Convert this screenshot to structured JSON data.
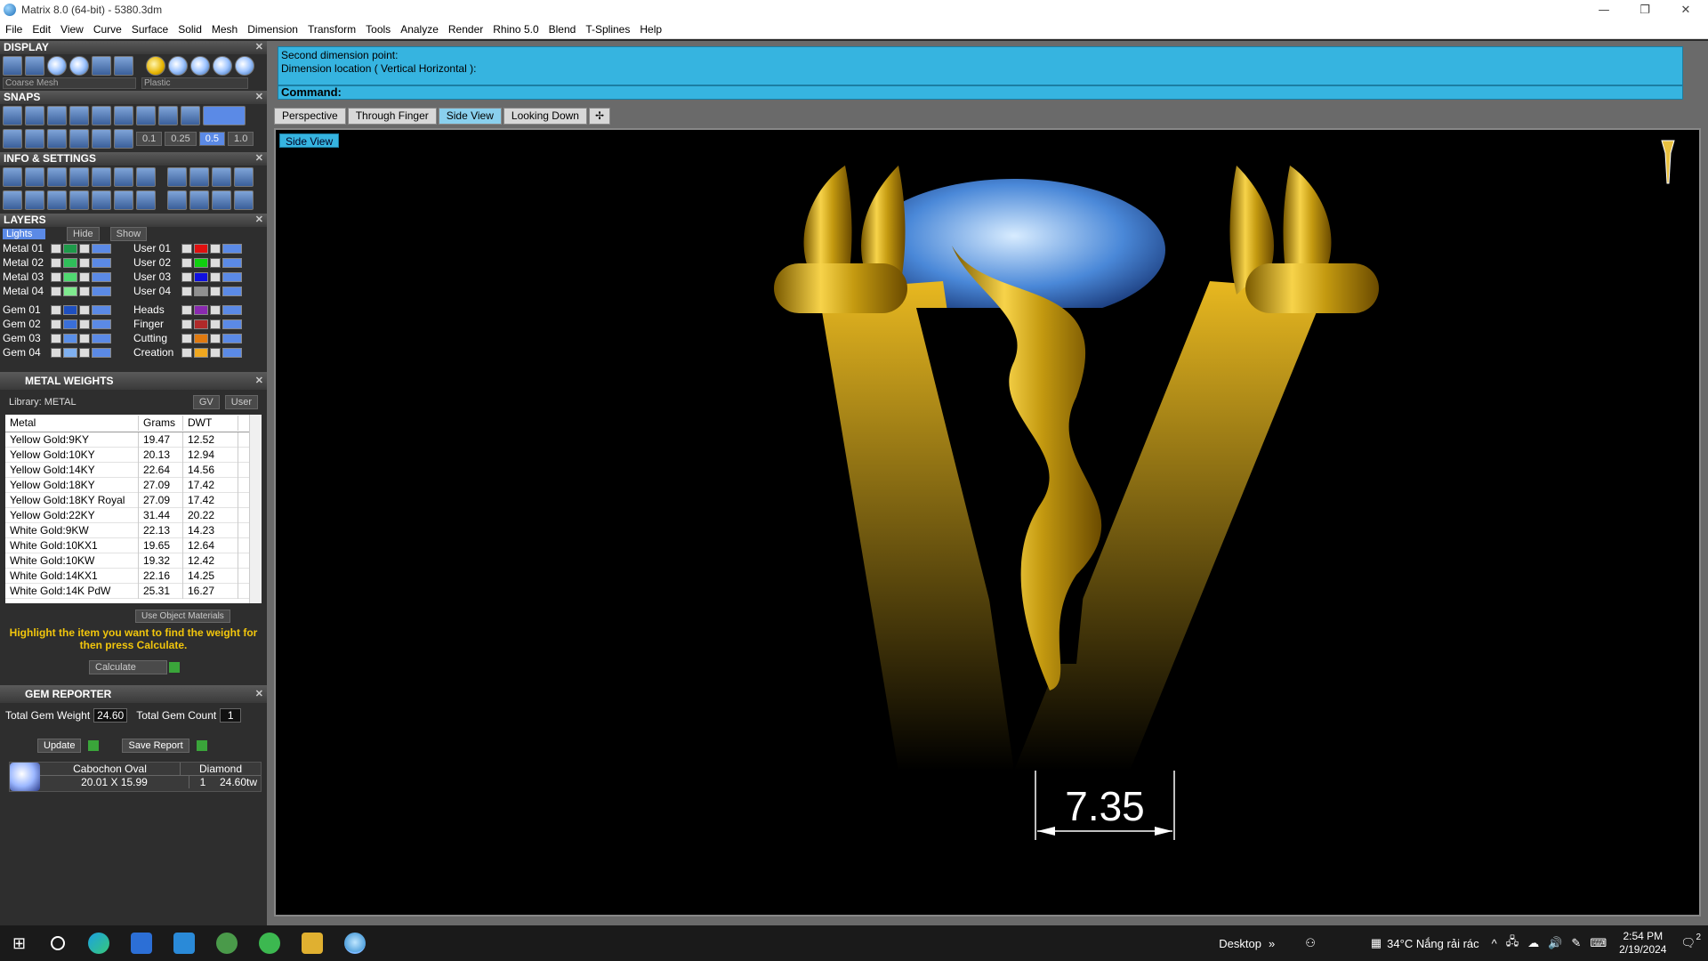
{
  "window": {
    "title": "Matrix 8.0 (64-bit) - 5380.3dm"
  },
  "menu": [
    "File",
    "Edit",
    "View",
    "Curve",
    "Surface",
    "Solid",
    "Mesh",
    "Dimension",
    "Transform",
    "Tools",
    "Analyze",
    "Render",
    "Rhino 5.0",
    "Blend",
    "T-Splines",
    "Help"
  ],
  "display": {
    "header": "DISPLAY",
    "mesh": "Coarse Mesh",
    "material": "Plastic"
  },
  "snaps": {
    "header": "SNAPS",
    "values": [
      "0.1",
      "0.25",
      "0.5",
      "1.0"
    ]
  },
  "info": {
    "header": "INFO & SETTINGS"
  },
  "layers": {
    "header": "LAYERS",
    "lights": "Lights",
    "hide": "Hide",
    "show": "Show",
    "left": [
      {
        "name": "Metal 01",
        "color": "#1e9a4a"
      },
      {
        "name": "Metal 02",
        "color": "#2fbf5a"
      },
      {
        "name": "Metal 03",
        "color": "#4fd870"
      },
      {
        "name": "Metal 04",
        "color": "#7fe98f"
      },
      {
        "name": "Gem 01",
        "color": "#1e4fbf"
      },
      {
        "name": "Gem 02",
        "color": "#3a6fd8"
      },
      {
        "name": "Gem 03",
        "color": "#5a8fe8"
      },
      {
        "name": "Gem 04",
        "color": "#7fb0f0"
      }
    ],
    "right": [
      {
        "name": "User 01",
        "color": "#e01010"
      },
      {
        "name": "User 02",
        "color": "#10d010"
      },
      {
        "name": "User 03",
        "color": "#1010e0"
      },
      {
        "name": "User 04",
        "color": "#909090"
      },
      {
        "name": "Heads",
        "color": "#8a2ab0"
      },
      {
        "name": "Finger",
        "color": "#b02a2a"
      },
      {
        "name": "Cutting",
        "color": "#e07a10"
      },
      {
        "name": "Creation",
        "color": "#f0a820"
      }
    ]
  },
  "metal_weights": {
    "header": "METAL WEIGHTS",
    "library": "Library: METAL",
    "gv": "GV",
    "user": "User",
    "columns": [
      "Metal",
      "Grams",
      "DWT"
    ],
    "rows": [
      [
        "Yellow Gold:9KY",
        "19.47",
        "12.52"
      ],
      [
        "Yellow Gold:10KY",
        "20.13",
        "12.94"
      ],
      [
        "Yellow Gold:14KY",
        "22.64",
        "14.56"
      ],
      [
        "Yellow Gold:18KY",
        "27.09",
        "17.42"
      ],
      [
        "Yellow Gold:18KY Royal",
        "27.09",
        "17.42"
      ],
      [
        "Yellow Gold:22KY",
        "31.44",
        "20.22"
      ],
      [
        "White Gold:9KW",
        "22.13",
        "14.23"
      ],
      [
        "White Gold:10KX1",
        "19.65",
        "12.64"
      ],
      [
        "White Gold:10KW",
        "19.32",
        "12.42"
      ],
      [
        "White Gold:14KX1",
        "22.16",
        "14.25"
      ],
      [
        "White Gold:14K PdW",
        "25.31",
        "16.27"
      ]
    ],
    "use_object": "Use Object Materials",
    "hint": "Highlight the item you want to find the weight for then press Calculate.",
    "calculate": "Calculate"
  },
  "gem_reporter": {
    "header": "GEM REPORTER",
    "total_weight_label": "Total Gem Weight",
    "total_weight": "24.60",
    "total_count_label": "Total Gem Count",
    "total_count": "1",
    "update": "Update",
    "save_report": "Save Report",
    "gem": {
      "shape": "Cabochon Oval",
      "type": "Diamond",
      "size": "20.01 X 15.99",
      "qty": "1",
      "weight": "24.60tw"
    }
  },
  "command": {
    "lines": [
      "Second dimension point:",
      "Dimension location ( Vertical  Horizontal ):"
    ],
    "prompt": "Command:"
  },
  "tabs": [
    "Perspective",
    "Through Finger",
    "Side View",
    "Looking Down"
  ],
  "active_tab": 2,
  "viewport": {
    "label": "Side View",
    "dimension": "7.35"
  },
  "taskbar": {
    "desktop": "Desktop",
    "weather": "34°C  Nắng rải rác",
    "time": "2:54 PM",
    "date": "2/19/2024",
    "notif": "2"
  }
}
